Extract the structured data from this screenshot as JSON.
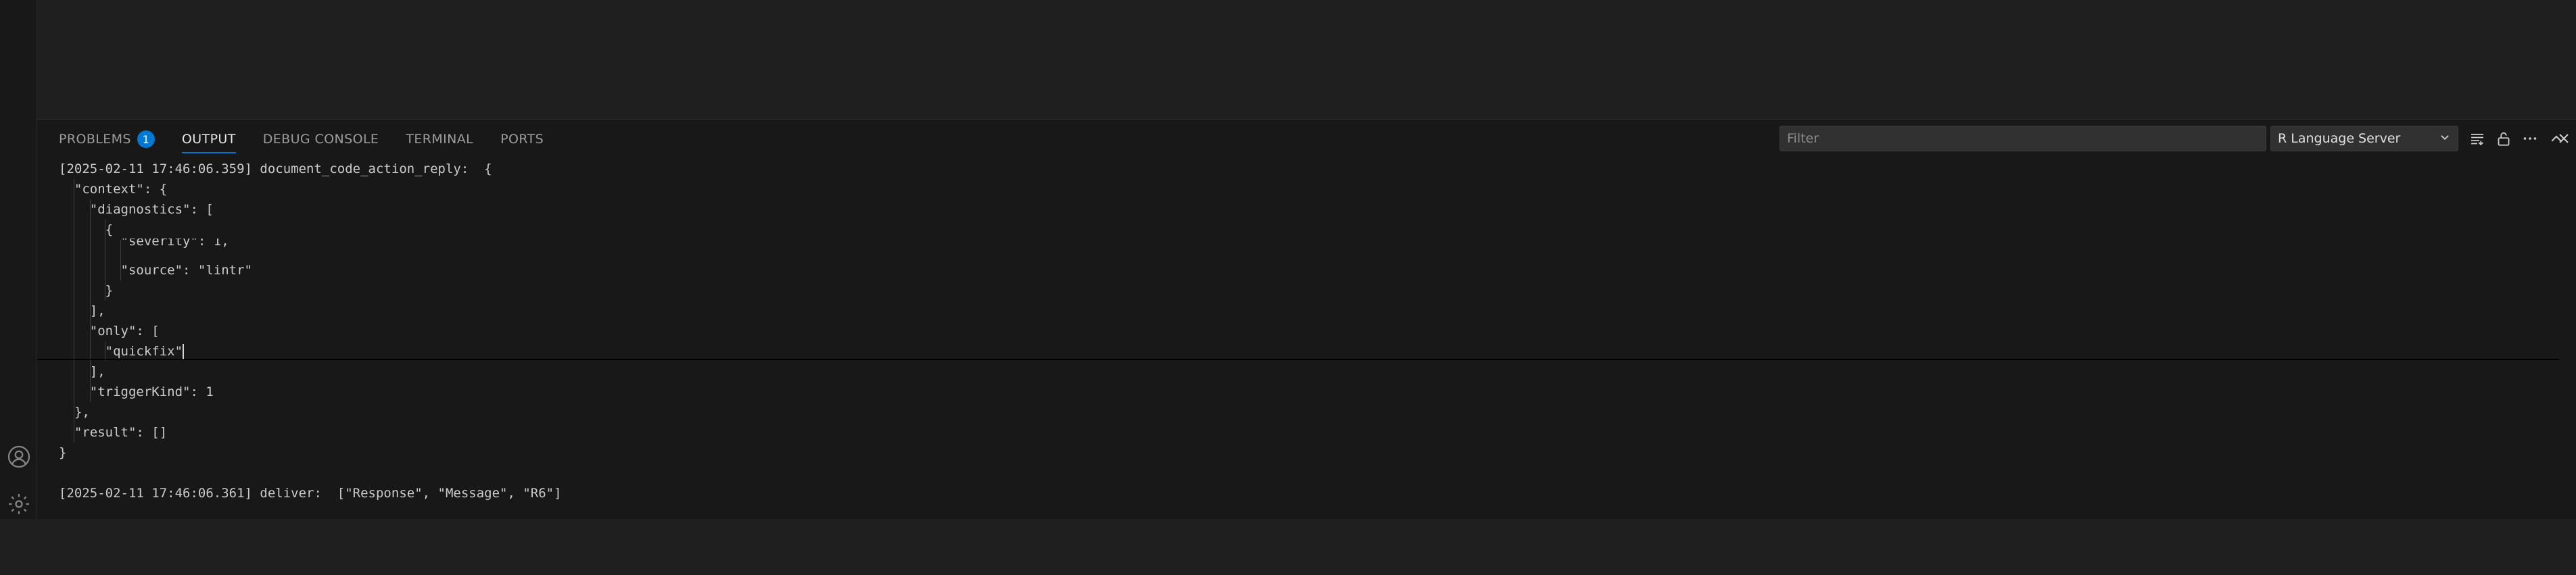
{
  "panel": {
    "tabs": [
      {
        "label": "PROBLEMS",
        "badge": "1"
      },
      {
        "label": "OUTPUT"
      },
      {
        "label": "DEBUG CONSOLE"
      },
      {
        "label": "TERMINAL"
      },
      {
        "label": "PORTS"
      }
    ],
    "active_tab": "OUTPUT",
    "filter": {
      "placeholder": "Filter",
      "value": ""
    },
    "channel": {
      "selected": "R Language Server"
    },
    "icons": {
      "list_icon": "list-filter-icon",
      "lock_icon": "unlock-icon",
      "more_icon": "ellipsis-icon",
      "maximize_icon": "chevron-up-icon",
      "close_icon": "close-icon"
    }
  },
  "activity_bar": {
    "icons": [
      "account-icon",
      "settings-gear-icon"
    ]
  },
  "output": {
    "lines": [
      "[2025-02-11 17:46:06.359] document_code_action_reply:  {",
      "  \"context\": {",
      "    \"diagnostics\": [",
      "      {",
      "        \"severity\": 1,",
      "        \"source\": \"lintr\"",
      "      }",
      "    ],",
      "    \"only\": [",
      "      \"quickfix\"",
      "    ],",
      "    \"triggerKind\": 1",
      "  },",
      "  \"result\": []",
      "}",
      "",
      "[2025-02-11 17:46:06.361] deliver:  [\"Response\", \"Message\", \"R6\"]"
    ]
  },
  "colors": {
    "accent": "#0078d4",
    "panel_bg": "#181818",
    "editor_bg": "#1f1f1f"
  }
}
